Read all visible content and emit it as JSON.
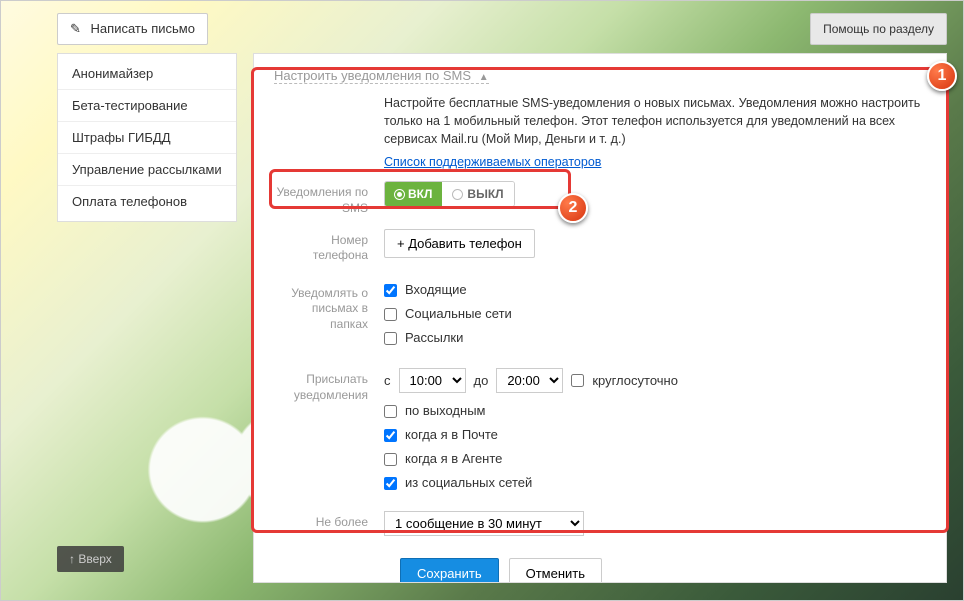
{
  "top": {
    "compose": "Написать письмо",
    "help": "Помощь по разделу"
  },
  "sidebar": {
    "items": [
      {
        "label": "Анонимайзер"
      },
      {
        "label": "Бета-тестирование"
      },
      {
        "label": "Штрафы ГИБДД"
      },
      {
        "label": "Управление рассылками"
      },
      {
        "label": "Оплата телефонов"
      }
    ]
  },
  "section": {
    "title": "Настроить уведомления по SMS",
    "desc": "Настройте бесплатные SMS-уведомления о новых письмах. Уведомления можно настроить только на 1 мобильный телефон. Этот телефон используется для уведомлений на всех сервисах Mail.ru (Мой Мир, Деньги и т. д.)",
    "operators_link": "Список поддерживаемых операторов"
  },
  "labels": {
    "sms_notify": "Уведомления по SMS",
    "phone": "Номер телефона",
    "folders": "Уведомлять о письмах в папках",
    "schedule": "Присылать уведомления",
    "limit": "Не более"
  },
  "toggle": {
    "on": "ВКЛ",
    "off": "ВЫКЛ"
  },
  "add_phone": "+  Добавить телефон",
  "folders": {
    "inbox": "Входящие",
    "social": "Социальные сети",
    "mailings": "Рассылки"
  },
  "schedule": {
    "from_label": "с",
    "from_value": "10:00",
    "to_label": "до",
    "to_value": "20:00",
    "all_day": "круглосуточно",
    "weekends": "по выходным",
    "in_mail": "когда я в Почте",
    "in_agent": "когда я в Агенте",
    "from_social": "из социальных сетей"
  },
  "limit_value": "1 сообщение в 30 минут",
  "save": "Сохранить",
  "cancel": "Отменить",
  "back_top": "↑  Вверх"
}
